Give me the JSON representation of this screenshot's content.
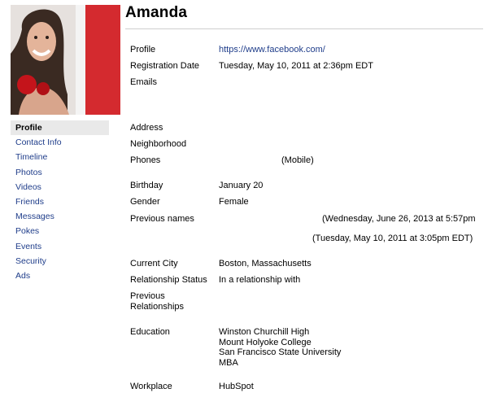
{
  "profile": {
    "name": "Amanda"
  },
  "sidebar": {
    "items": [
      {
        "label": "Profile",
        "active": true
      },
      {
        "label": "Contact Info"
      },
      {
        "label": "Timeline"
      },
      {
        "label": "Photos"
      },
      {
        "label": "Videos"
      },
      {
        "label": "Friends"
      },
      {
        "label": "Messages"
      },
      {
        "label": "Pokes"
      },
      {
        "label": "Events"
      },
      {
        "label": "Security"
      },
      {
        "label": "Ads"
      }
    ]
  },
  "labels": {
    "profile": "Profile",
    "registration_date": "Registration Date",
    "emails": "Emails",
    "address": "Address",
    "neighborhood": "Neighborhood",
    "phones": "Phones",
    "birthday": "Birthday",
    "gender": "Gender",
    "previous_names": "Previous names",
    "current_city": "Current City",
    "relationship_status": "Relationship Status",
    "previous_relationships_1": "Previous",
    "previous_relationships_2": "Relationships",
    "education": "Education",
    "workplace": "Workplace"
  },
  "values": {
    "profile_url": "https://www.facebook.com/",
    "registration_date": "Tuesday, May 10, 2011 at 2:36pm EDT",
    "phone_type": "(Mobile)",
    "birthday": "January 20",
    "gender": "Female",
    "previous_name_1": "(Wednesday, June 26, 2013 at 5:57pm",
    "previous_name_2": "(Tuesday, May 10, 2011 at 3:05pm EDT)",
    "current_city": "Boston, Massachusetts",
    "relationship_status": "In a relationship with",
    "education": [
      "Winston Churchill High",
      "Mount Holyoke College",
      "San Francisco State University",
      "MBA"
    ],
    "workplace": "HubSpot"
  },
  "colors": {
    "link": "#1f3d8a",
    "accent_red": "#d42a2f",
    "active_bg": "#e9e9e9"
  }
}
